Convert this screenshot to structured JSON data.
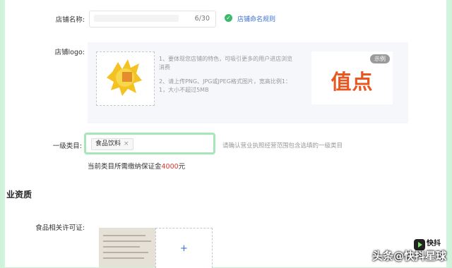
{
  "store_name": {
    "label": "店铺名称:",
    "counter": "6/30",
    "rule_link": "店铺命名规则"
  },
  "store_logo": {
    "label": "店铺logo:",
    "tips": [
      "1、要体现您店铺的特色，可吸引更多的用户进店浏览消费",
      "2、请上传PNG、JPG或JPEG格式图片，宽高比例1：1，大小不超过5MB"
    ],
    "sample_badge": "示例",
    "sample_text": "值点"
  },
  "category": {
    "label": "一级类目:",
    "tag": "食品饮料",
    "tag_close": "×",
    "hint": "请确认营业执照经营范围包含选填的一级类目",
    "deposit_prefix": "当前类目所需缴纳保证金",
    "deposit_amount": "4000",
    "deposit_suffix": "元"
  },
  "qualification": {
    "section_title": "业资质",
    "license_label": "食品相关许可证:",
    "upload_plus": "+"
  },
  "watermark": {
    "text": "头条@快抖星球",
    "badge": "快抖"
  },
  "colors": {
    "accent_green": "#a6e6b9",
    "link_blue": "#3a73d9",
    "amount_red": "#e2382d",
    "sample_orange": "#e9561f"
  }
}
